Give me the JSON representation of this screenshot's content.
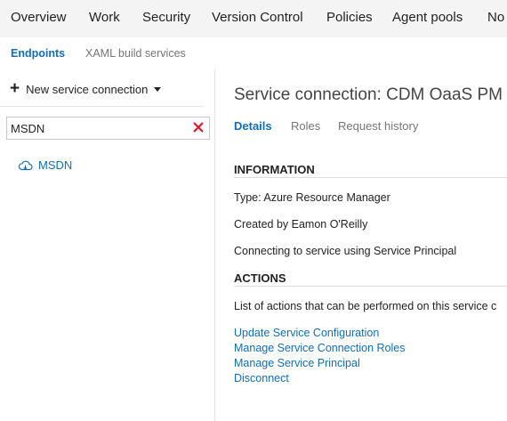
{
  "topnav": {
    "tabs": [
      "Overview",
      "Work",
      "Security",
      "Version Control",
      "Policies",
      "Agent pools",
      "No"
    ]
  },
  "subnav": {
    "endpoints": "Endpoints",
    "xaml": "XAML build services"
  },
  "left": {
    "new_connection_label": "New service connection",
    "filter_value": "MSDN",
    "items": [
      {
        "label": "MSDN",
        "icon": "cloud-icon"
      }
    ]
  },
  "detail": {
    "title": "Service connection: CDM OaaS PM (F",
    "tabs": [
      "Details",
      "Roles",
      "Request history"
    ],
    "information_heading": "INFORMATION",
    "type_line": "Type: Azure Resource Manager",
    "created_line": "Created by Eamon O'Reilly",
    "connecting_line": "Connecting to service using Service Principal",
    "actions_heading": "ACTIONS",
    "actions_desc": "List of actions that can be performed on this service c",
    "actions": [
      "Update Service Configuration",
      "Manage Service Connection Roles",
      "Manage Service Principal",
      "Disconnect"
    ]
  },
  "colors": {
    "accent": "#106ebe",
    "clear_icon": "#e81123",
    "nav_bg": "#f4f4f4"
  }
}
